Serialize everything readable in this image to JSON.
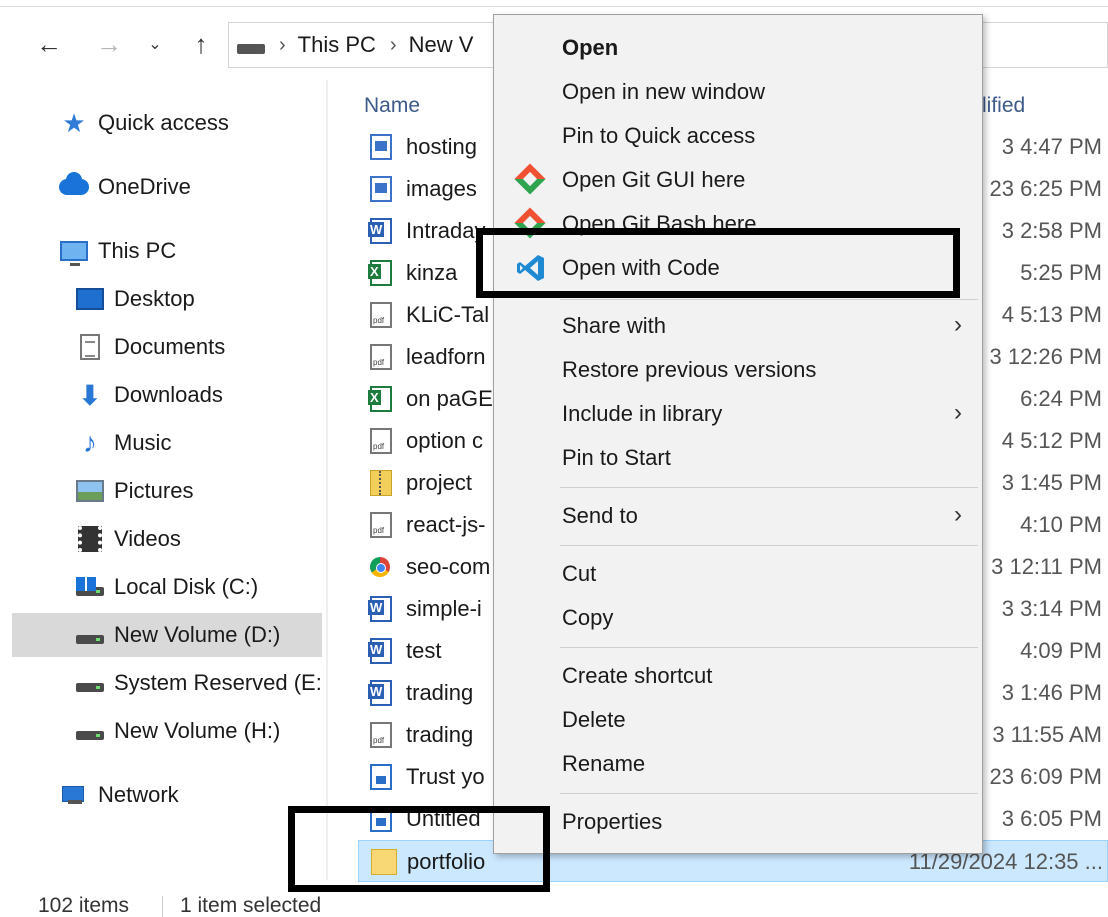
{
  "nav": {
    "back_icon": "arrow-left-icon",
    "forward_icon": "arrow-right-icon",
    "recent_icon": "chevron-down-icon",
    "up_icon": "arrow-up-icon"
  },
  "address": {
    "crumbs": [
      "This PC",
      "New V"
    ]
  },
  "sidebar": {
    "items": [
      {
        "label": "Quick access",
        "icon": "star-icon"
      },
      {
        "label": "OneDrive",
        "icon": "cloud-icon"
      },
      {
        "label": "This PC",
        "icon": "computer-icon"
      },
      {
        "label": "Desktop",
        "icon": "desktop-icon"
      },
      {
        "label": "Documents",
        "icon": "documents-icon"
      },
      {
        "label": "Downloads",
        "icon": "downloads-icon"
      },
      {
        "label": "Music",
        "icon": "music-icon"
      },
      {
        "label": "Pictures",
        "icon": "pictures-icon"
      },
      {
        "label": "Videos",
        "icon": "videos-icon"
      },
      {
        "label": "Local Disk (C:)",
        "icon": "drive-icon"
      },
      {
        "label": "New Volume (D:)",
        "icon": "drive-icon",
        "selected": true
      },
      {
        "label": "System Reserved (E:",
        "icon": "drive-icon"
      },
      {
        "label": "New Volume (H:)",
        "icon": "drive-icon"
      },
      {
        "label": "Network",
        "icon": "network-icon"
      }
    ]
  },
  "list": {
    "col_name": "Name",
    "col_modified": "lified",
    "files": [
      {
        "name": "hosting",
        "date": "3 4:47 PM",
        "type": "image"
      },
      {
        "name": "images",
        "date": "23 6:25 PM",
        "type": "image"
      },
      {
        "name": "Intraday",
        "date": "3 2:58 PM",
        "type": "word"
      },
      {
        "name": "kinza",
        "date": "5:25 PM",
        "type": "excel"
      },
      {
        "name": "KLiC-Tal",
        "date": "4 5:13 PM",
        "type": "pdf"
      },
      {
        "name": "leadforn",
        "date": "3 12:26 PM",
        "type": "pdf"
      },
      {
        "name": "on paGE",
        "date": "6:24 PM",
        "type": "excel"
      },
      {
        "name": "option c",
        "date": "4 5:12 PM",
        "type": "pdf"
      },
      {
        "name": "project",
        "date": "3 1:45 PM",
        "type": "zip"
      },
      {
        "name": "react-js-",
        "date": "4:10 PM",
        "type": "pdf"
      },
      {
        "name": "seo-com",
        "date": "3 12:11 PM",
        "type": "chrome"
      },
      {
        "name": "simple-i",
        "date": "3 3:14 PM",
        "type": "word"
      },
      {
        "name": "test",
        "date": "4:09 PM",
        "type": "word"
      },
      {
        "name": "trading",
        "date": "3 1:46 PM",
        "type": "word"
      },
      {
        "name": "trading",
        "date": "3 11:55 AM",
        "type": "pdf"
      },
      {
        "name": "Trust yo",
        "date": "23 6:09 PM",
        "type": "generic"
      },
      {
        "name": "Untitled",
        "date": "3 6:05 PM",
        "type": "generic"
      },
      {
        "name": "portfolio",
        "date": "11/29/2024 12:35 ...",
        "type": "folder",
        "selected": true
      }
    ]
  },
  "status": {
    "count": "102 items",
    "selection": "1 item selected"
  },
  "context_menu": {
    "items": [
      {
        "label": "Open",
        "bold": true
      },
      {
        "label": "Open in new window"
      },
      {
        "label": "Pin to Quick access"
      },
      {
        "label": "Open Git GUI here",
        "icon": "git-icon"
      },
      {
        "label": "Open Git Bash here",
        "icon": "git-icon"
      },
      {
        "label": "Open with Code",
        "icon": "vscode-icon"
      },
      {
        "label": "Share with",
        "submenu": true
      },
      {
        "label": "Restore previous versions"
      },
      {
        "label": "Include in library",
        "submenu": true
      },
      {
        "label": "Pin to Start"
      },
      {
        "label": "Send to",
        "submenu": true
      },
      {
        "label": "Cut"
      },
      {
        "label": "Copy"
      },
      {
        "label": "Create shortcut"
      },
      {
        "label": "Delete"
      },
      {
        "label": "Rename"
      },
      {
        "label": "Properties"
      }
    ],
    "submenu_arrow": "›"
  }
}
